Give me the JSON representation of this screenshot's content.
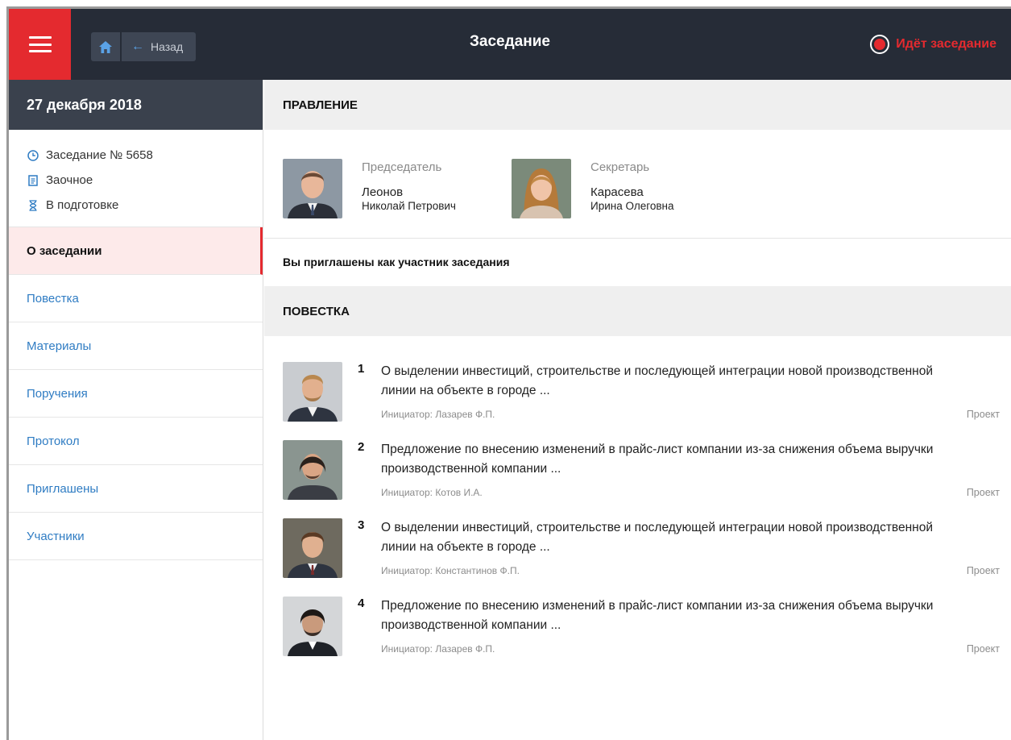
{
  "header": {
    "title": "Заседание",
    "back_label": "Назад",
    "status_text": "Идёт заседание",
    "menu_icon": "hamburger-icon",
    "home_icon": "home-icon"
  },
  "sidebar": {
    "date": "27 декабря 2018",
    "meta": [
      {
        "icon": "clock-icon",
        "text": "Заседание № 5658"
      },
      {
        "icon": "document-icon",
        "text": "Заочное"
      },
      {
        "icon": "hourglass-icon",
        "text": "В подготовке"
      }
    ],
    "nav": [
      {
        "label": "О заседании",
        "active": true
      },
      {
        "label": "Повестка",
        "active": false
      },
      {
        "label": "Материалы",
        "active": false
      },
      {
        "label": "Поручения",
        "active": false
      },
      {
        "label": "Протокол",
        "active": false
      },
      {
        "label": "Приглашены",
        "active": false
      },
      {
        "label": "Участники",
        "active": false
      }
    ]
  },
  "board": {
    "heading": "ПРАВЛЕНИЕ",
    "chair": {
      "role": "Председатель",
      "surname": "Леонов",
      "given": "Николай Петрович"
    },
    "secretary": {
      "role": "Секретарь",
      "surname": "Карасева",
      "given": "Ирина Олеговна"
    }
  },
  "invite_text": "Вы приглашены как участник заседания",
  "agenda": {
    "heading": "ПОВЕСТКА",
    "items": [
      {
        "num": "1",
        "title": "О выделении инвестиций, строительстве и последующей интеграции новой производственной линии на объекте в городе ...",
        "initiator": "Инициатор: Лазарев Ф.П.",
        "status": "Проект"
      },
      {
        "num": "2",
        "title": "Предложение по внесению изменений в прайс-лист компании из-за снижения объема выручки производственной компании ...",
        "initiator": "Инициатор: Котов И.А.",
        "status": "Проект"
      },
      {
        "num": "3",
        "title": "О выделении инвестиций, строительстве и последующей интеграции новой производственной линии на объекте в городе ...",
        "initiator": "Инициатор: Константинов Ф.П.",
        "status": "Проект"
      },
      {
        "num": "4",
        "title": "Предложение по внесению изменений в прайс-лист компании из-за снижения объема выручки производственной компании ...",
        "initiator": "Инициатор: Лазарев Ф.П.",
        "status": "Проект"
      }
    ]
  },
  "colors": {
    "accent": "#e42a2f",
    "topbar": "#262c37",
    "link": "#2f7cc3"
  }
}
